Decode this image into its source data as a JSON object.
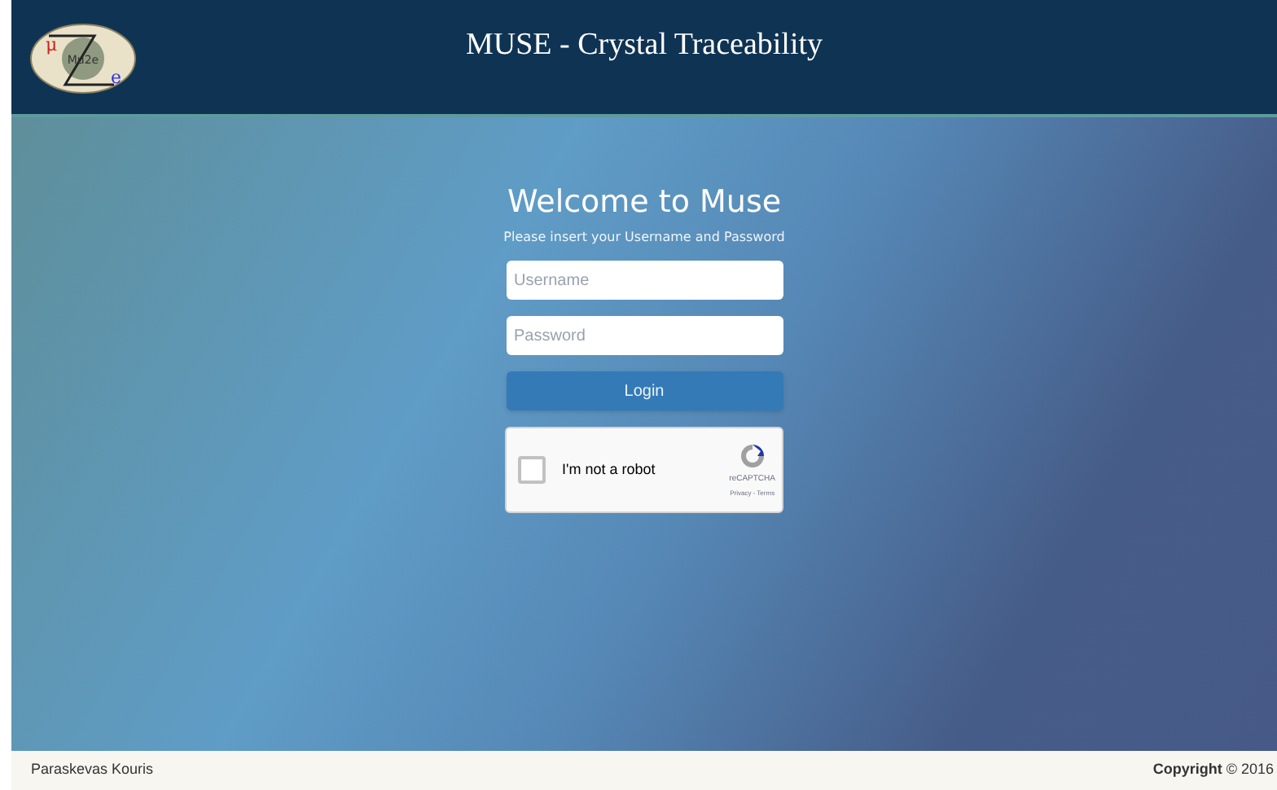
{
  "header": {
    "logo": {
      "center": "Mu2e",
      "left": "μ",
      "right": "e"
    },
    "title": "MUSE - Crystal Traceability"
  },
  "login": {
    "heading": "Welcome to Muse",
    "subheading": "Please insert your Username and Password",
    "username": {
      "placeholder": "Username"
    },
    "password": {
      "placeholder": "Password"
    },
    "button": "Login",
    "captcha": {
      "label": "I'm not a robot",
      "checked": false,
      "brand": "reCAPTCHA",
      "links": "Privacy - Terms"
    }
  },
  "footer": {
    "author": "Paraskevas Kouris",
    "copyright": "**Copyright** © 2016"
  }
}
